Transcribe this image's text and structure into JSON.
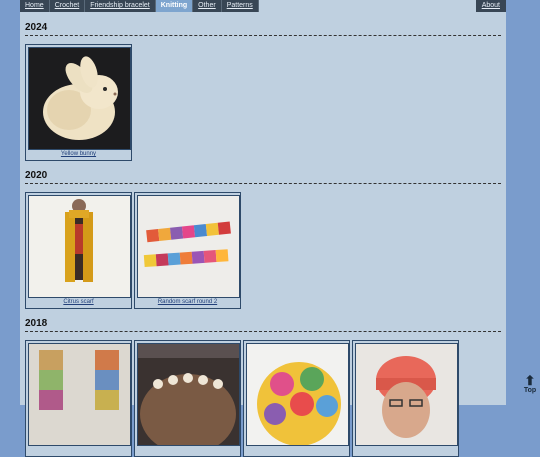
{
  "nav": {
    "items": [
      "Home",
      "Crochet",
      "Friendship bracelet",
      "Knitting",
      "Other",
      "Patterns"
    ],
    "active": "Knitting",
    "about": "About"
  },
  "sections": [
    {
      "year": "2024",
      "items": [
        {
          "caption": "Yellow bunny"
        }
      ]
    },
    {
      "year": "2020",
      "items": [
        {
          "caption": "Citrus scarf"
        },
        {
          "caption": "Random scarf round 2"
        }
      ]
    },
    {
      "year": "2018",
      "items": [
        {
          "caption": ""
        },
        {
          "caption": ""
        },
        {
          "caption": ""
        },
        {
          "caption": ""
        }
      ]
    }
  ],
  "top_button": {
    "label": "Top",
    "icon": "arrow-up-icon"
  },
  "colors": {
    "page_bg": "#bfd0e0",
    "side_bg": "#7a9ccc",
    "nav_bg": "#384655",
    "nav_active": "#7ea5cf"
  }
}
